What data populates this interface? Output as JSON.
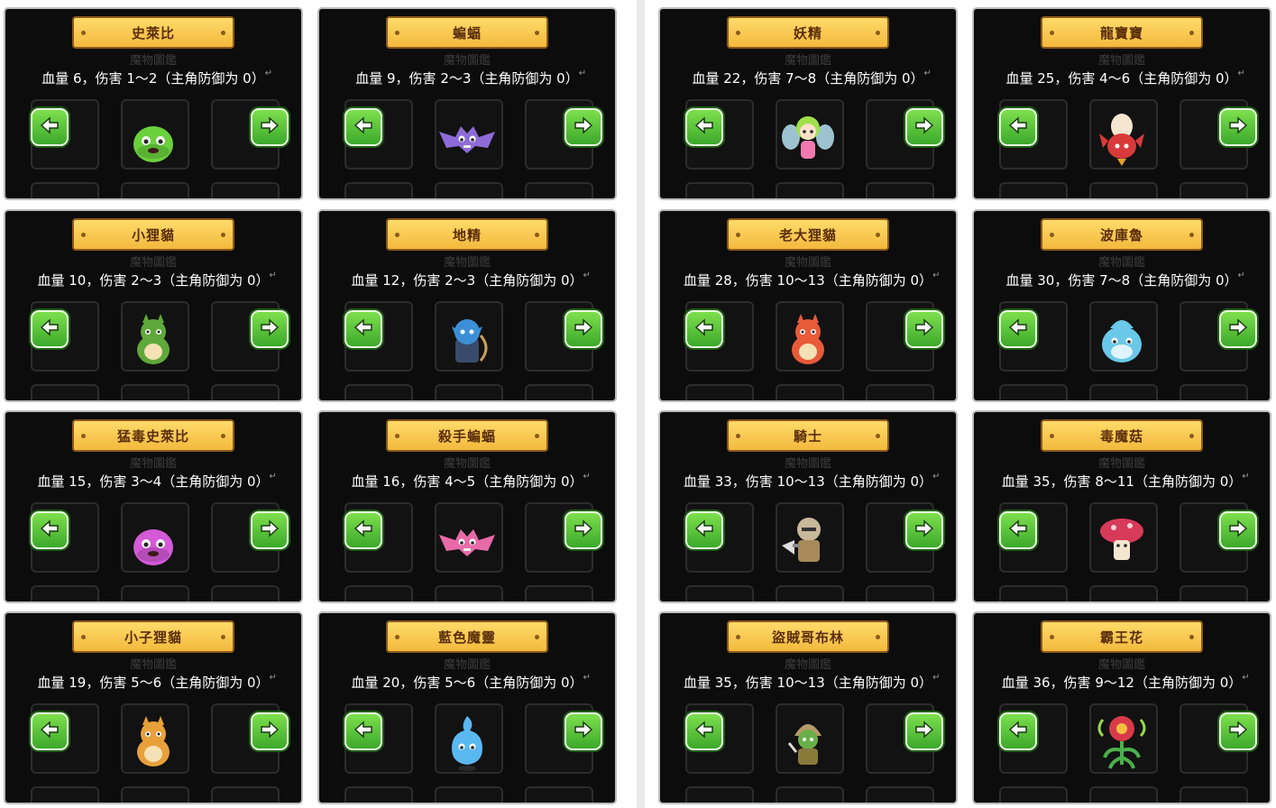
{
  "monsters": [
    {
      "name": "史萊比",
      "stat": "血量 6，伤害 1～2（主角防御为 0）",
      "color": "#6ad13c",
      "shape": "slime-icon"
    },
    {
      "name": "蝙蝠",
      "stat": "血量 9，伤害 2～3（主角防御为 0）",
      "color": "#8e6bd6",
      "shape": "bat-icon"
    },
    {
      "name": "小狸貓",
      "stat": "血量 10，伤害 2～3（主角防御为 0）",
      "color": "#5fa83a",
      "shape": "raccoon-icon"
    },
    {
      "name": "地精",
      "stat": "血量 12，伤害 2～3（主角防御为 0）",
      "color": "#3c8fd6",
      "shape": "goblin-icon"
    },
    {
      "name": "猛毒史萊比",
      "stat": "血量 15，伤害 3～4（主角防御为 0）",
      "color": "#d45ad8",
      "shape": "slime-icon"
    },
    {
      "name": "殺手蝙蝠",
      "stat": "血量 16，伤害 4～5（主角防御为 0）",
      "color": "#e86aa8",
      "shape": "bat-icon"
    },
    {
      "name": "小子狸貓",
      "stat": "血量 19，伤害 5～6（主角防御为 0）",
      "color": "#e8a03a",
      "shape": "raccoon-icon"
    },
    {
      "name": "藍色魔靈",
      "stat": "血量 20，伤害 5～6（主角防御为 0）",
      "color": "#5ab8f0",
      "shape": "ghost-icon"
    },
    {
      "name": "妖精",
      "stat": "血量 22，伤害 7～8（主角防御为 0）",
      "color": "#9fe04a",
      "shape": "fairy-icon"
    },
    {
      "name": "龍寶寶",
      "stat": "血量 25，伤害 4～6（主角防御为 0）",
      "color": "#d83a3a",
      "shape": "dragon-icon"
    },
    {
      "name": "老大狸貓",
      "stat": "血量 28，伤害 10～13（主角防御为 0）",
      "color": "#e85a3a",
      "shape": "raccoon-icon"
    },
    {
      "name": "波庫魯",
      "stat": "血量 30，伤害 7～8（主角防御为 0）",
      "color": "#6ac8e8",
      "shape": "poku-icon"
    },
    {
      "name": "騎士",
      "stat": "血量 33，伤害 10～13（主角防御为 0）",
      "color": "#c8b89a",
      "shape": "knight-icon"
    },
    {
      "name": "毒魔菇",
      "stat": "血量 35，伤害 8～11（主角防御为 0）",
      "color": "#d83a5a",
      "shape": "mushroom-icon"
    },
    {
      "name": "盜賊哥布林",
      "stat": "血量 35，伤害 10～13（主角防御为 0）",
      "color": "#8a7a3a",
      "shape": "thief-icon"
    },
    {
      "name": "霸王花",
      "stat": "血量 36，伤害 9～12（主角防御为 0）",
      "color": "#d83a4a",
      "shape": "flower-icon"
    }
  ],
  "ghost_label": "魔物圖鑑",
  "left_arrow_icon": "arrow-left-icon",
  "right_arrow_icon": "arrow-right-icon",
  "paragraph_mark": "↵"
}
